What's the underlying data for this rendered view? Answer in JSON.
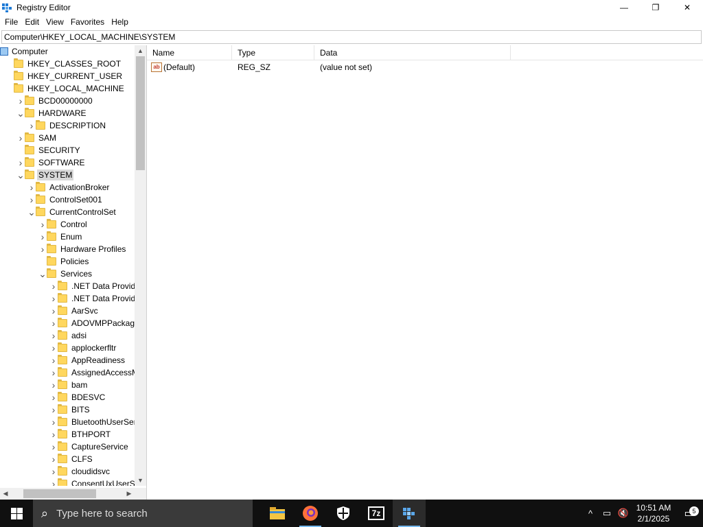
{
  "window": {
    "title": "Registry Editor",
    "minimize_glyph": "—",
    "maximize_glyph": "❐",
    "close_glyph": "✕"
  },
  "menu": {
    "file": "File",
    "edit": "Edit",
    "view": "View",
    "favorites": "Favorites",
    "help": "Help"
  },
  "address": {
    "path": "Computer\\HKEY_LOCAL_MACHINE\\SYSTEM"
  },
  "tree": {
    "selected": "SYSTEM",
    "nodes": [
      {
        "label": "Computer",
        "depth": 0,
        "expander": "",
        "icon": "computer-icon"
      },
      {
        "label": "HKEY_CLASSES_ROOT",
        "depth": 1,
        "expander": "",
        "icon": "folder-icon"
      },
      {
        "label": "HKEY_CURRENT_USER",
        "depth": 1,
        "expander": "",
        "icon": "folder-icon"
      },
      {
        "label": "HKEY_LOCAL_MACHINE",
        "depth": 1,
        "expander": "",
        "icon": "folder-icon"
      },
      {
        "label": "BCD00000000",
        "depth": 2,
        "expander": ">",
        "icon": "folder-icon"
      },
      {
        "label": "HARDWARE",
        "depth": 2,
        "expander": "v",
        "icon": "folder-icon"
      },
      {
        "label": "DESCRIPTION",
        "depth": 3,
        "expander": ">",
        "icon": "folder-icon"
      },
      {
        "label": "SAM",
        "depth": 2,
        "expander": ">",
        "icon": "folder-icon"
      },
      {
        "label": "SECURITY",
        "depth": 2,
        "expander": "",
        "icon": "folder-icon"
      },
      {
        "label": "SOFTWARE",
        "depth": 2,
        "expander": ">",
        "icon": "folder-icon"
      },
      {
        "label": "SYSTEM",
        "depth": 2,
        "expander": "v",
        "icon": "folder-icon"
      },
      {
        "label": "ActivationBroker",
        "depth": 3,
        "expander": ">",
        "icon": "folder-icon"
      },
      {
        "label": "ControlSet001",
        "depth": 3,
        "expander": ">",
        "icon": "folder-icon"
      },
      {
        "label": "CurrentControlSet",
        "depth": 3,
        "expander": "v",
        "icon": "folder-icon"
      },
      {
        "label": "Control",
        "depth": 4,
        "expander": ">",
        "icon": "folder-icon"
      },
      {
        "label": "Enum",
        "depth": 4,
        "expander": ">",
        "icon": "folder-icon"
      },
      {
        "label": "Hardware Profiles",
        "depth": 4,
        "expander": ">",
        "icon": "folder-icon"
      },
      {
        "label": "Policies",
        "depth": 4,
        "expander": "",
        "icon": "folder-icon"
      },
      {
        "label": "Services",
        "depth": 4,
        "expander": "v",
        "icon": "folder-icon"
      },
      {
        "label": ".NET Data Provider",
        "depth": 5,
        "expander": ">",
        "icon": "folder-icon"
      },
      {
        "label": ".NET Data Provider",
        "depth": 5,
        "expander": ">",
        "icon": "folder-icon"
      },
      {
        "label": "AarSvc",
        "depth": 5,
        "expander": ">",
        "icon": "folder-icon"
      },
      {
        "label": "ADOVMPPackage",
        "depth": 5,
        "expander": ">",
        "icon": "folder-icon"
      },
      {
        "label": "adsi",
        "depth": 5,
        "expander": ">",
        "icon": "folder-icon"
      },
      {
        "label": "applockerfltr",
        "depth": 5,
        "expander": ">",
        "icon": "folder-icon"
      },
      {
        "label": "AppReadiness",
        "depth": 5,
        "expander": ">",
        "icon": "folder-icon"
      },
      {
        "label": "AssignedAccessMa",
        "depth": 5,
        "expander": ">",
        "icon": "folder-icon"
      },
      {
        "label": "bam",
        "depth": 5,
        "expander": ">",
        "icon": "folder-icon"
      },
      {
        "label": "BDESVC",
        "depth": 5,
        "expander": ">",
        "icon": "folder-icon"
      },
      {
        "label": "BITS",
        "depth": 5,
        "expander": ">",
        "icon": "folder-icon"
      },
      {
        "label": "BluetoothUserServi",
        "depth": 5,
        "expander": ">",
        "icon": "folder-icon"
      },
      {
        "label": "BTHPORT",
        "depth": 5,
        "expander": ">",
        "icon": "folder-icon"
      },
      {
        "label": "CaptureService",
        "depth": 5,
        "expander": ">",
        "icon": "folder-icon"
      },
      {
        "label": "CLFS",
        "depth": 5,
        "expander": ">",
        "icon": "folder-icon"
      },
      {
        "label": "cloudidsvc",
        "depth": 5,
        "expander": ">",
        "icon": "folder-icon"
      },
      {
        "label": "ConsentUxUserSvc",
        "depth": 5,
        "expander": ">",
        "icon": "folder-icon"
      }
    ]
  },
  "values_list": {
    "columns": [
      "Name",
      "Type",
      "Data"
    ],
    "rows": [
      {
        "name": "(Default)",
        "type": "REG_SZ",
        "data": "(value not set)",
        "icon": "string-value-icon",
        "icon_text": "ab"
      }
    ]
  },
  "taskbar": {
    "search_placeholder": "Type here to search",
    "apps": [
      {
        "name": "file-explorer",
        "icon": "folder-icon",
        "active": false,
        "running": false
      },
      {
        "name": "firefox",
        "icon": "firefox-icon",
        "active": false,
        "running": true
      },
      {
        "name": "windows-security",
        "icon": "shield-icon",
        "active": false,
        "running": false
      },
      {
        "name": "7zip",
        "icon": "7zip-icon",
        "active": false,
        "running": false,
        "label": "7z"
      },
      {
        "name": "registry-editor",
        "icon": "regedit-icon",
        "active": true,
        "running": true
      }
    ],
    "clock_time": "10:51 AM",
    "clock_date": "2/1/2025",
    "notification_count": "5"
  },
  "colors": {
    "taskbar_bg": "#101010",
    "search_bg": "#3a3a3a",
    "folder_yellow": "#ffd75e",
    "selected_bg": "#d9d9d9",
    "running_indicator": "#76b9ed"
  }
}
